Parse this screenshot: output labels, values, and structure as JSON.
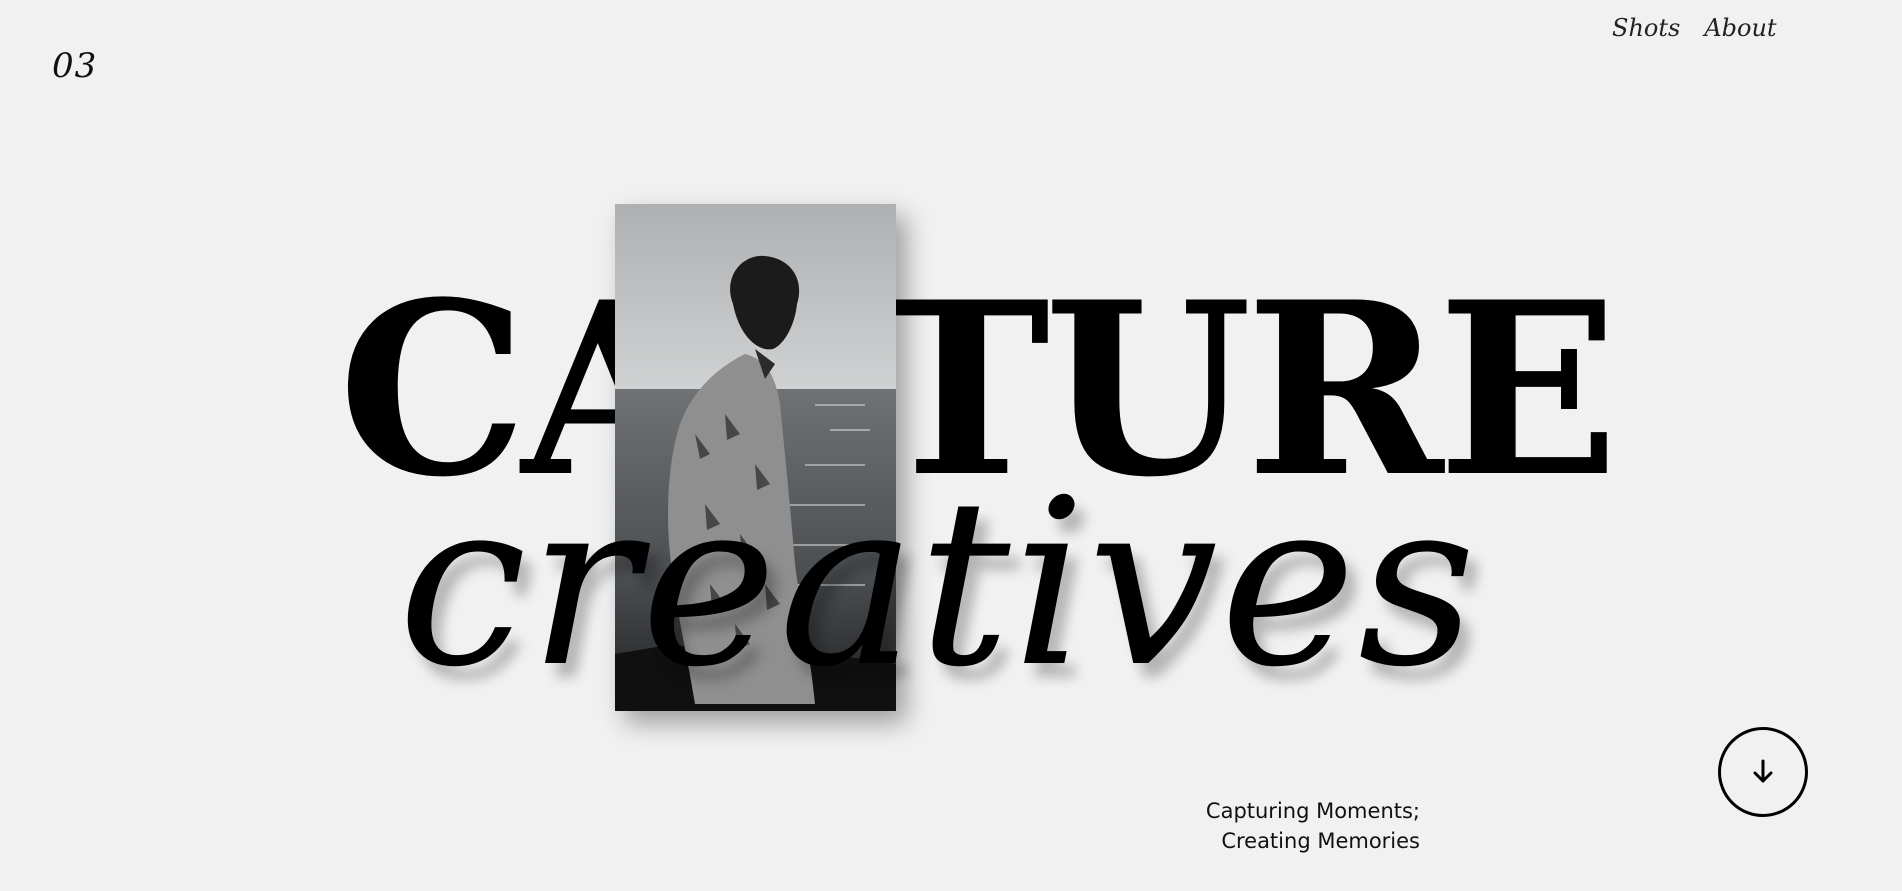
{
  "header": {
    "logo": "03",
    "nav": [
      {
        "label": "Shots"
      },
      {
        "label": "About"
      }
    ]
  },
  "hero": {
    "headline": "CAPTURE",
    "script_word": "creatives",
    "photo_alt_icon": "portrait-photo",
    "tagline_line1": "Capturing Moments;",
    "tagline_line2": "Creating Memories"
  },
  "scroll_button": {
    "icon": "arrow-down-icon"
  },
  "colors": {
    "background": "#f1f1f1",
    "text": "#000000"
  }
}
